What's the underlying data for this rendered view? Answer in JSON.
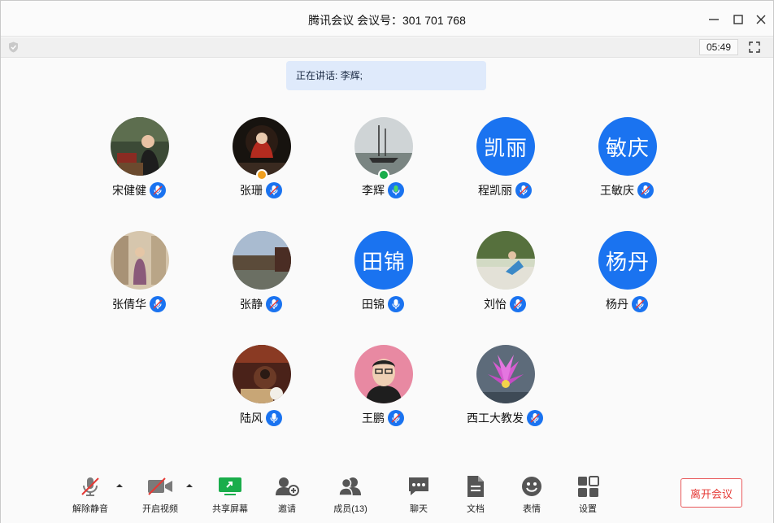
{
  "window": {
    "title": "腾讯会议 会议号：301 701 768",
    "timer": "05:49"
  },
  "speaking": {
    "text": "正在讲话: 李辉;"
  },
  "participants": [
    {
      "name": "宋健健",
      "avatar": "photo",
      "mic": "muted"
    },
    {
      "name": "张珊",
      "avatar": "photo",
      "mic": "muted",
      "badge": "host"
    },
    {
      "name": "李辉",
      "avatar": "photo",
      "mic": "active",
      "badge": "cohost"
    },
    {
      "name": "程凯丽",
      "avatar_text": "凯丽",
      "mic": "muted"
    },
    {
      "name": "王敏庆",
      "avatar_text": "敏庆",
      "mic": "muted"
    },
    {
      "name": "张倩华",
      "avatar": "photo",
      "mic": "muted"
    },
    {
      "name": "张静",
      "avatar": "photo",
      "mic": "muted"
    },
    {
      "name": "田锦",
      "avatar_text": "田锦",
      "mic": "on"
    },
    {
      "name": "刘怡",
      "avatar": "photo",
      "mic": "muted"
    },
    {
      "name": "杨丹",
      "avatar_text": "杨丹",
      "mic": "muted"
    },
    {
      "name": "陆风",
      "avatar": "photo",
      "mic": "on"
    },
    {
      "name": "王鹏",
      "avatar": "photo",
      "mic": "muted"
    },
    {
      "name": "西工大教发",
      "avatar": "photo",
      "mic": "muted"
    }
  ],
  "toolbar": {
    "unmute": "解除静音",
    "video": "开启视频",
    "share": "共享屏幕",
    "invite": "邀请",
    "members": "成员(13)",
    "chat": "聊天",
    "docs": "文档",
    "emoji": "表情",
    "settings": "设置",
    "leave": "离开会议"
  },
  "colors": {
    "accent": "#1a73f0",
    "leave": "#e53935",
    "share_green": "#1aad4b"
  }
}
